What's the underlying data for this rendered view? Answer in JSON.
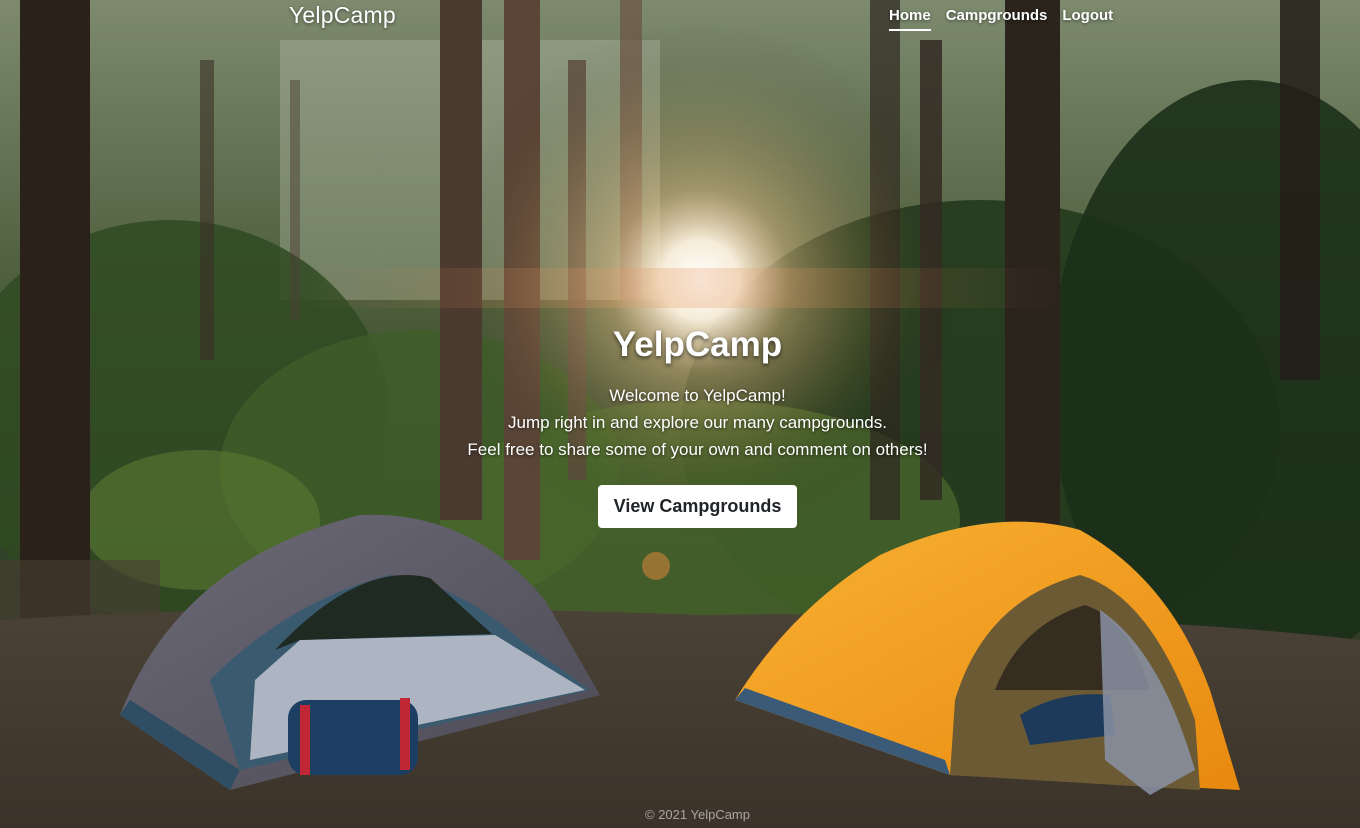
{
  "navbar": {
    "brand": "YelpCamp",
    "links": [
      {
        "label": "Home",
        "active": true
      },
      {
        "label": "Campgrounds",
        "active": false
      },
      {
        "label": "Logout",
        "active": false
      }
    ]
  },
  "hero": {
    "title": "YelpCamp",
    "lines": [
      "Welcome to YelpCamp!",
      "Jump right in and explore our many campgrounds.",
      "Feel free to share some of your own and comment on others!"
    ],
    "button_label": "View Campgrounds"
  },
  "footer": {
    "text": "© 2021 YelpCamp"
  },
  "colors": {
    "text": "#ffffff",
    "button_bg": "#ffffff",
    "button_text": "#212529",
    "forest_dark": "#1e2a1a",
    "tent_orange": "#f5a21d",
    "tent_gray": "#5f6170"
  }
}
